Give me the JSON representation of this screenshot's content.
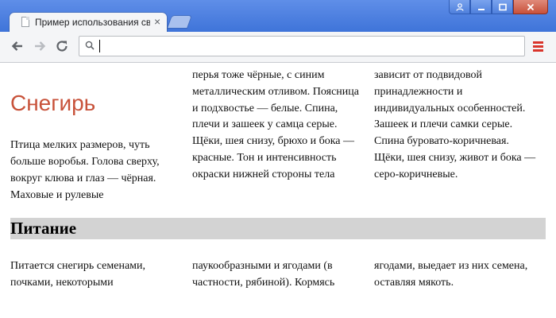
{
  "browser": {
    "tab_title": "Пример использования свойства",
    "tab_close": "×",
    "address_value": "",
    "colors": {
      "titlebar": "#4a7fe0",
      "menu": "#d9342b"
    },
    "icons": {
      "back": "arrow-left-icon",
      "forward": "arrow-right-icon",
      "reload": "reload-icon",
      "search": "search-icon",
      "menu": "hamburger-menu-icon",
      "user": "user-icon",
      "minimize": "minimize-icon",
      "maximize": "maximize-icon",
      "close": "close-icon"
    }
  },
  "article": {
    "title": "Снегирь",
    "title_color": "#c8523a",
    "section1": {
      "col1": "Птица мелких размеров, чуть больше воробья. Голова сверху, вокруг клюва и глаз — чёрная. Маховые и рулевые",
      "col2": "перья тоже чёрные, с синим металлическим отливом. Поясница и подхвостье — белые. Спина, плечи и зашеек у самца серые. Щёки, шея снизу, брюхо и бока — красные. Тон и интенсивность окраски нижней стороны тела",
      "col3": "зависит от подвидовой принадлежности и индивидуальных особенностей. Зашеек и плечи самки серые. Спина буровато-коричневая. Щёки, шея снизу, живот и бока — серо-коричневые."
    },
    "heading2": "Питание",
    "section2": {
      "col1": "Питается снегирь семенами, почками, некоторыми",
      "col2": "паукообразными и ягодами (в частности, рябиной). Кормясь",
      "col3": "ягодами, выедает из них семена, оставляя мякоть."
    }
  }
}
